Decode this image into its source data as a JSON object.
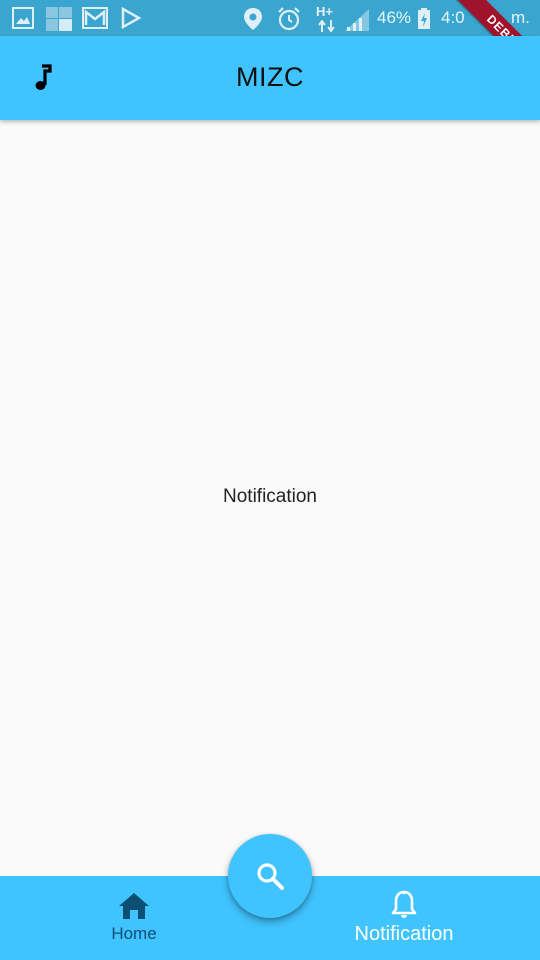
{
  "status_bar": {
    "battery_text": "46%",
    "network_text": "H+",
    "time_text": "4:0",
    "time_suffix": "m."
  },
  "debug_banner": {
    "label": "DEBUG"
  },
  "app_bar": {
    "title": "MIZC",
    "leading_icon": "music-note-icon"
  },
  "body": {
    "text": "Notification"
  },
  "fab": {
    "icon": "search-icon"
  },
  "bottom_nav": {
    "items": [
      {
        "label": "Home",
        "icon": "home-icon",
        "selected": false
      },
      {
        "label": "Notification",
        "icon": "bell-icon",
        "selected": true
      }
    ]
  },
  "colors": {
    "primary": "#40c4ff",
    "status_bar": "#3aa6cf",
    "background": "#fafafa",
    "debug": "#a0132c"
  }
}
